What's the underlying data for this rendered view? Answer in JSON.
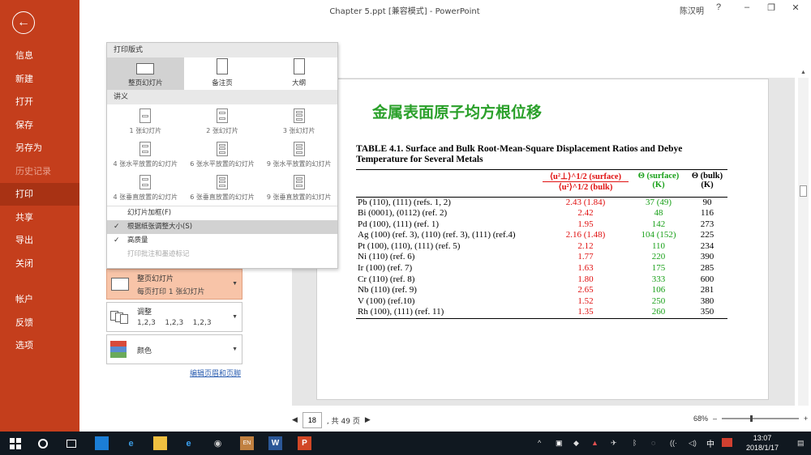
{
  "window": {
    "title": "Chapter 5.ppt [兼容模式] - PowerPoint",
    "user": "陈汉明",
    "help": "?"
  },
  "nav": {
    "back_icon": "←",
    "items": [
      "信息",
      "新建",
      "打开",
      "保存",
      "另存为",
      "历史记录",
      "打印",
      "共享",
      "导出",
      "关闭",
      "帐户",
      "反馈",
      "选项"
    ]
  },
  "menu": {
    "print_layout_header": "打印版式",
    "layouts": [
      "整页幻灯片",
      "备注页",
      "大纲"
    ],
    "handouts_header": "讲义",
    "handouts": [
      "1 张幻灯片",
      "2 张幻灯片",
      "3 张幻灯片",
      "4 张水平放置的幻灯片",
      "6 张水平放置的幻灯片",
      "9 张水平放置的幻灯片",
      "4 张垂直放置的幻灯片",
      "6 张垂直放置的幻灯片",
      "9 张垂直放置的幻灯片"
    ],
    "options": [
      "幻灯片加框(F)",
      "根据纸张调整大小(S)",
      "高质量",
      "打印批注和墨迹标记"
    ]
  },
  "settings": {
    "layout_title": "整页幻灯片",
    "layout_sub": "每页打印 1 张幻灯片",
    "collate_title": "调整",
    "collate_sub": "1,2,3    1,2,3    1,2,3",
    "color_title": "颜色",
    "edit_header_footer": "编辑页眉和页脚"
  },
  "slide": {
    "title": "金属表面原子均方根位移",
    "caption_line1": "TABLE 4.1.  Surface and Bulk Root-Mean-Square Displacement Ratios and Debye",
    "caption_line2": "Temperature for Several Metals",
    "col_ratio_top": "⟨u²⊥⟩^1/2 (surface)",
    "col_ratio_bot": "⟨u²⟩^1/2 (bulk)",
    "col_surface": "Θ (surface)",
    "col_surface_unit": "(K)",
    "col_bulk": "Θ (bulk)",
    "col_bulk_unit": "(K)",
    "rows": [
      [
        "Pb (110), (111) (refs. 1, 2)",
        "2.43 (1.84)",
        "37 (49)",
        "90"
      ],
      [
        "Bi (0001), (0112) (ref. 2)",
        "2.42",
        "48",
        "116"
      ],
      [
        "Pd (100), (111) (ref. 1)",
        "1.95",
        "142",
        "273"
      ],
      [
        "Ag (100) (ref. 3), (110) (ref. 3), (111) (ref.4)",
        "2.16 (1.48)",
        "104 (152)",
        "225"
      ],
      [
        "Pt (100), (110), (111) (ref. 5)",
        "2.12",
        "110",
        "234"
      ],
      [
        "Ni (110) (ref. 6)",
        "1.77",
        "220",
        "390"
      ],
      [
        "Ir (100) (ref. 7)",
        "1.63",
        "175",
        "285"
      ],
      [
        "Cr (110) (ref. 8)",
        "1.80",
        "333",
        "600"
      ],
      [
        "Nb (110) (ref. 9)",
        "2.65",
        "106",
        "281"
      ],
      [
        "V (100) (ref.10)",
        "1.52",
        "250",
        "380"
      ],
      [
        "Rh (100), (111) (ref. 11)",
        "1.35",
        "260",
        "350"
      ]
    ]
  },
  "page_nav": {
    "current": "18",
    "total_text": ", 共 49 页"
  },
  "zoom": {
    "level": "68%"
  },
  "taskbar": {
    "time": "13:07",
    "date": "2018/1/17",
    "ime": "中"
  }
}
